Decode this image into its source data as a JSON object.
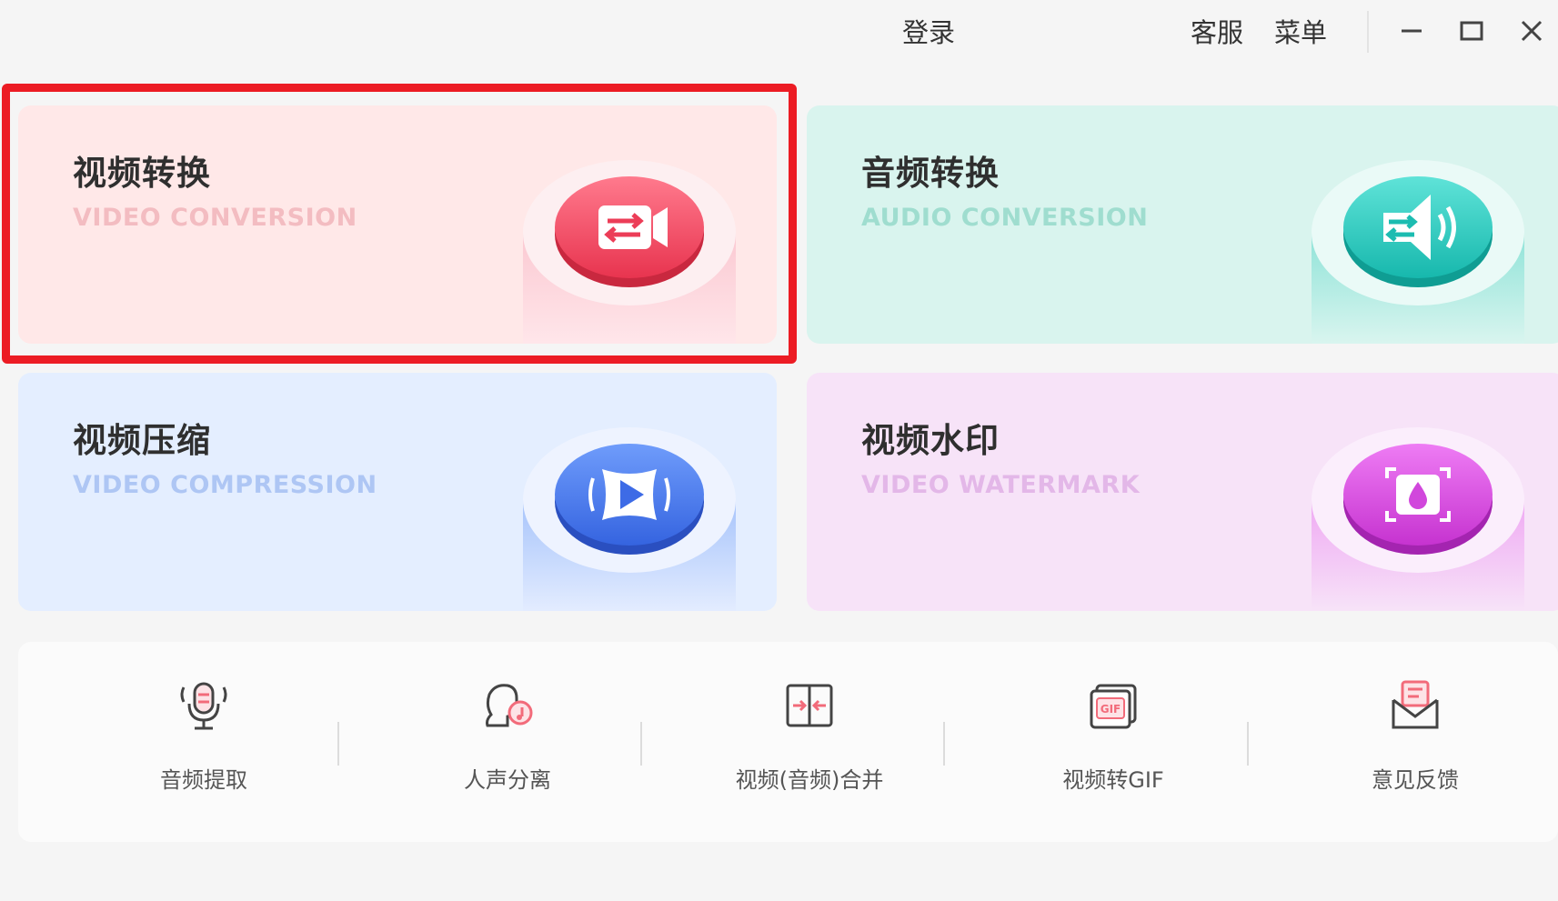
{
  "titlebar": {
    "login": "登录",
    "service": "客服",
    "menu": "菜单"
  },
  "cards": [
    {
      "title": "视频转换",
      "subtitle": "VIDEO CONVERSION",
      "icon": "video-convert-icon",
      "bg": "#ffe8e8",
      "sub_color": "#f3bcc1",
      "accent": "#f0506e"
    },
    {
      "title": "音频转换",
      "subtitle": "AUDIO CONVERSION",
      "icon": "audio-convert-icon",
      "bg": "#d9f4ee",
      "sub_color": "#9fddcf",
      "accent": "#2ccdc0"
    },
    {
      "title": "视频压缩",
      "subtitle": "VIDEO COMPRESSION",
      "icon": "video-compress-icon",
      "bg": "#e4eeff",
      "sub_color": "#aec6f4",
      "accent": "#4b7cf0"
    },
    {
      "title": "视频水印",
      "subtitle": "VIDEO WATERMARK",
      "icon": "video-watermark-icon",
      "bg": "#f7e3f8",
      "sub_color": "#e3b7e8",
      "accent": "#d653e0"
    }
  ],
  "tools": [
    {
      "label": "音频提取",
      "icon": "microphone-icon"
    },
    {
      "label": "人声分离",
      "icon": "voice-separation-icon"
    },
    {
      "label": "视频(音频)合并",
      "icon": "merge-icon"
    },
    {
      "label": "视频转GIF",
      "icon": "gif-icon"
    },
    {
      "label": "意见反馈",
      "icon": "feedback-mail-icon"
    }
  ],
  "colors": {
    "highlight": "#ec1c24",
    "icon_stroke": "#444444",
    "icon_accent": "#f26b7a"
  }
}
